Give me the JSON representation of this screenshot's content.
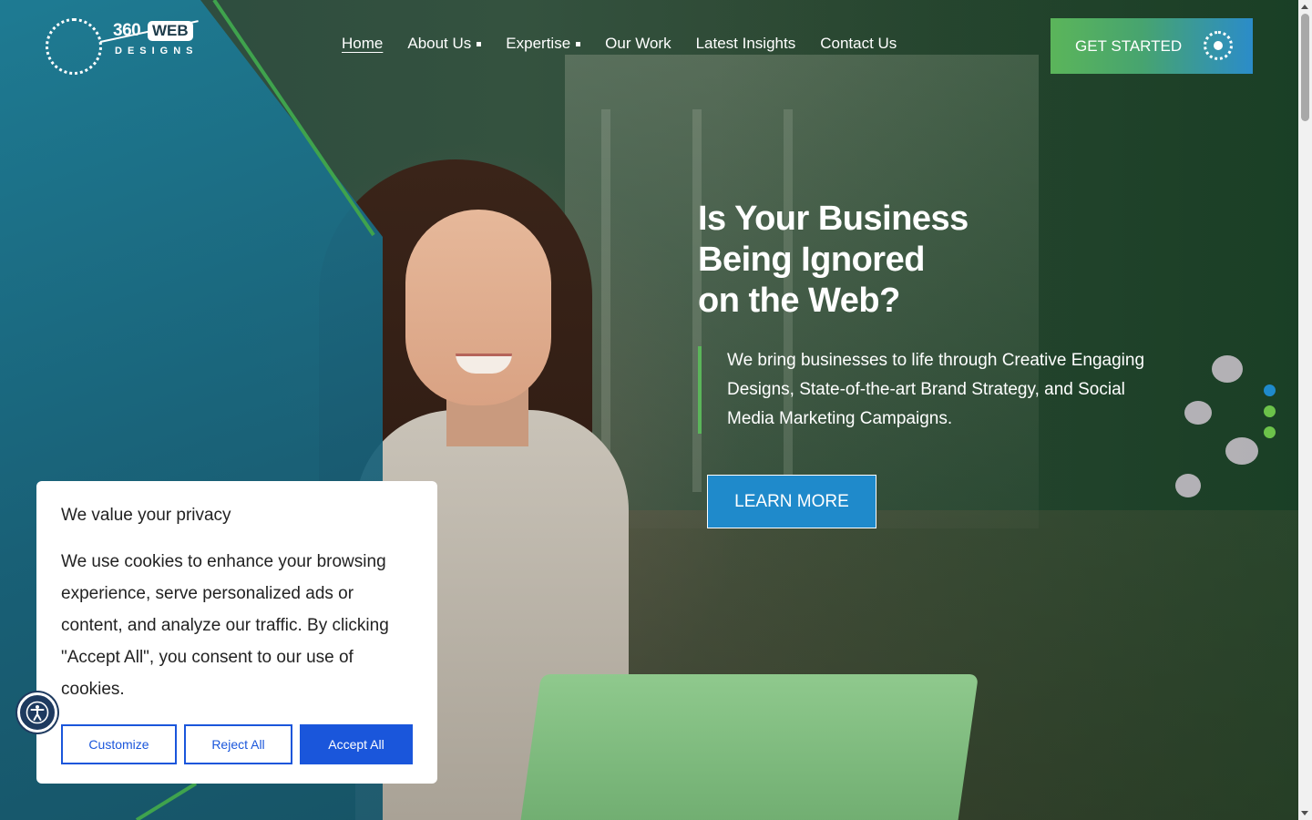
{
  "brand": {
    "logo_number": "360",
    "logo_web": "WEB",
    "logo_sub": "DESIGNS"
  },
  "nav": {
    "items": [
      {
        "label": "Home",
        "active": true,
        "dropdown": false
      },
      {
        "label": "About Us",
        "active": false,
        "dropdown": true
      },
      {
        "label": "Expertise",
        "active": false,
        "dropdown": true
      },
      {
        "label": "Our Work",
        "active": false,
        "dropdown": false
      },
      {
        "label": "Latest Insights",
        "active": false,
        "dropdown": false
      },
      {
        "label": "Contact Us",
        "active": false,
        "dropdown": false
      }
    ],
    "cta_label": "GET STARTED"
  },
  "hero": {
    "headline_lines": [
      "Is Your Business",
      "Being Ignored",
      "on the Web?"
    ],
    "subtext": "We bring businesses to life through Creative Engaging Designs, State-of-the-art Brand Strategy, and Social Media Marketing Campaigns.",
    "button_label": "LEARN MORE",
    "slide_count": 3,
    "active_slide": 1
  },
  "cookie_banner": {
    "title": "We value your privacy",
    "body": "We use cookies to enhance your browsing experience, serve personalized ads or content, and analyze our traffic. By clicking \"Accept All\", you consent to our use of cookies.",
    "customize_label": "Customize",
    "reject_label": "Reject All",
    "accept_label": "Accept All"
  },
  "colors": {
    "accent_green": "#5bb55a",
    "accent_blue": "#1f8acb",
    "consent_blue": "#1a56db",
    "teal_panel": "#17617a",
    "dot_active": "#1f8acb",
    "dot_inactive": "#6cc24a"
  },
  "icons": {
    "accessibility": "accessibility-icon",
    "cta": "circle-target-icon"
  }
}
